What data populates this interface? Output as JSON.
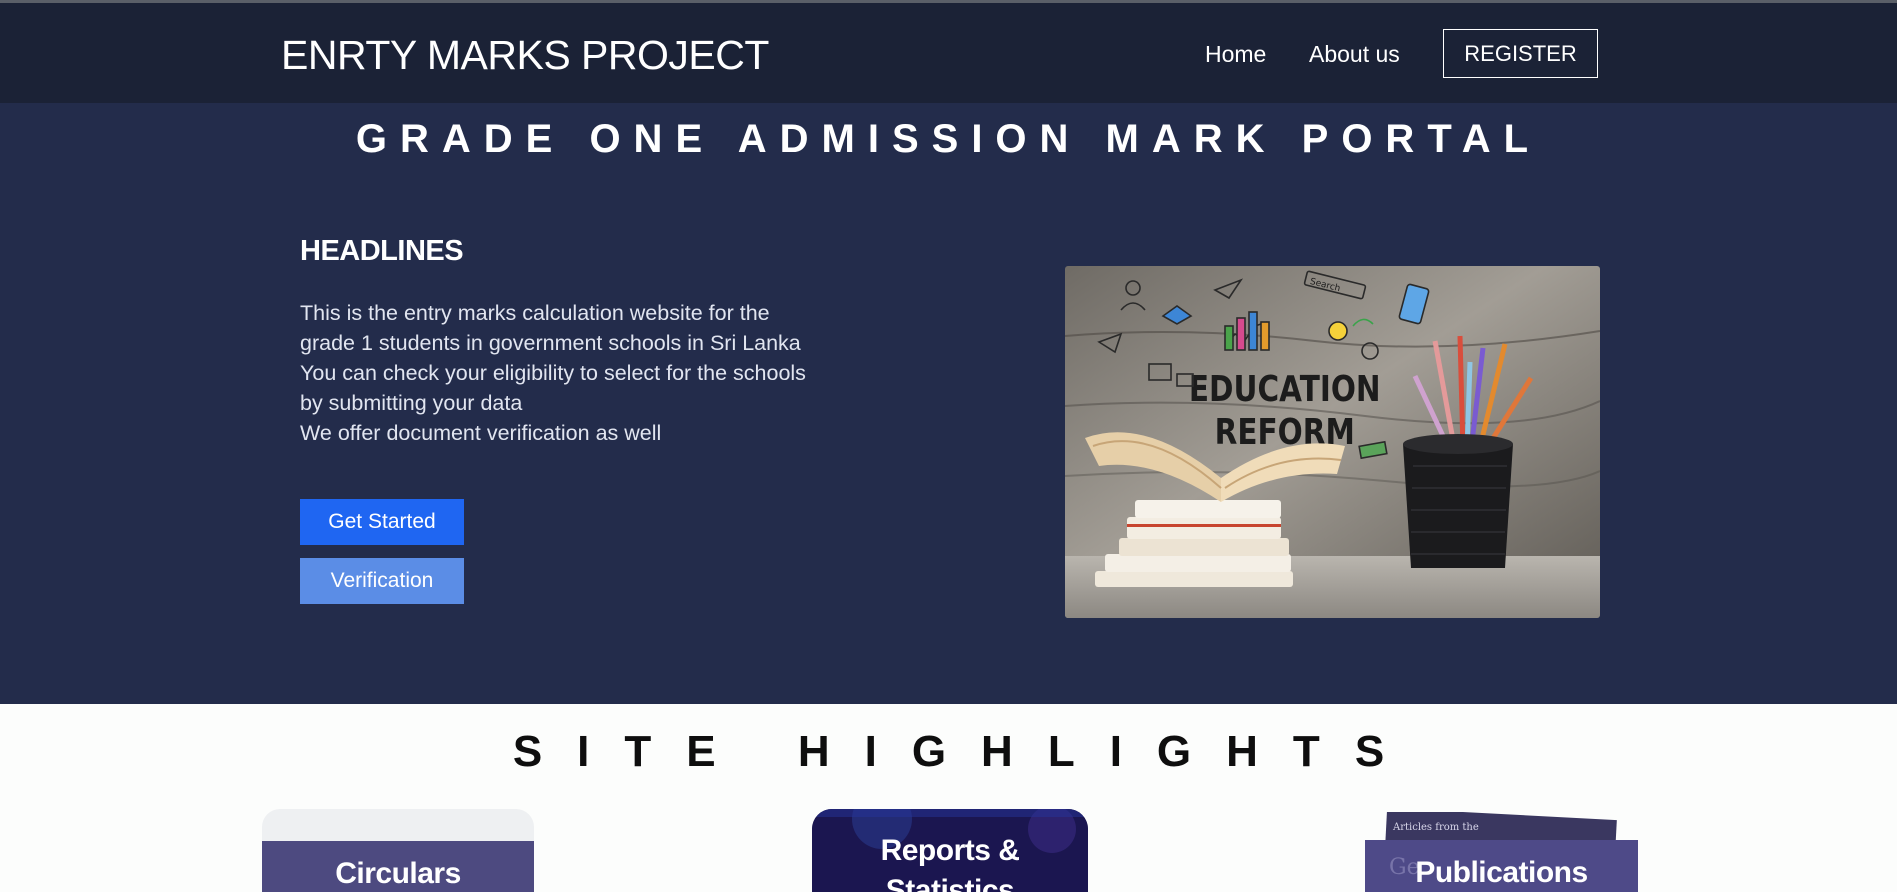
{
  "nav": {
    "brand": "ENRTY MARKS PROJECT",
    "home": "Home",
    "about": "About us",
    "register": "REGISTER"
  },
  "hero": {
    "title": "GRADE ONE ADMISSION MARK PORTAL",
    "headlines_heading": "HEADLINES",
    "lines": [
      "This is the entry marks calculation website for the",
      "grade 1 students in government schools in Sri Lanka",
      "You can check your eligibility to select for the schools",
      "by submitting your data",
      "We offer document verification as well"
    ],
    "get_started": "Get Started",
    "verification": "Verification",
    "image_text": [
      "EDUCATION",
      "REFORM"
    ],
    "image_search_label": "Search"
  },
  "highlights": {
    "title": "SITE HIGHLIGHTS",
    "cards": [
      {
        "label": "Circulars"
      },
      {
        "label": "Reports &",
        "label2": "Statistics"
      },
      {
        "label": "Publications",
        "magazine_text": "Articles from the"
      }
    ]
  },
  "colors": {
    "navbar": "#1b2236",
    "hero": "#232c4b",
    "primary_button": "#1f66f2",
    "secondary_button": "#5b8de6"
  }
}
